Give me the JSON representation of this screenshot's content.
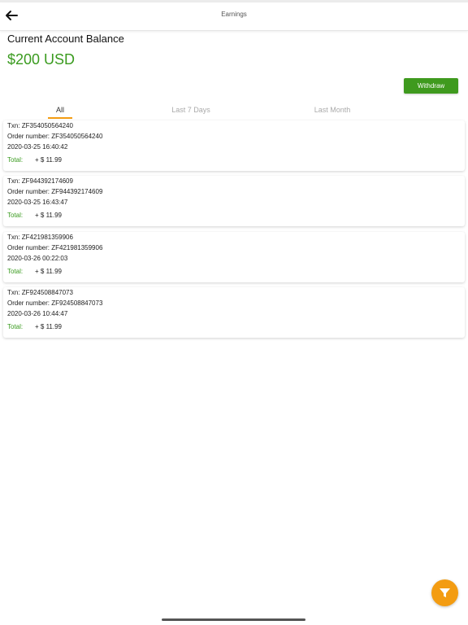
{
  "header": {
    "title": "Earnings",
    "back_icon": "arrow-left-icon"
  },
  "balance": {
    "label": "Current Account Balance",
    "value": "$200 USD"
  },
  "withdraw": {
    "label": "Withdraw"
  },
  "tabs": [
    {
      "label": "All",
      "active": true
    },
    {
      "label": "Last 7 Days",
      "active": false
    },
    {
      "label": "Last Month",
      "active": false
    }
  ],
  "transactions": [
    {
      "txn": "Txn: ZF354050564240",
      "order": "Order number: ZF354050564240",
      "date": "2020-03-25 16:40:42",
      "total_label": "Total:",
      "total_value": "+ $ 11.99"
    },
    {
      "txn": "Txn: ZF944392174609",
      "order": "Order number: ZF944392174609",
      "date": "2020-03-25 16:43:47",
      "total_label": "Total:",
      "total_value": "+ $ 11.99"
    },
    {
      "txn": "Txn: ZF421981359906",
      "order": "Order number: ZF421981359906",
      "date": "2020-03-26 00:22:03",
      "total_label": "Total:",
      "total_value": "+ $ 11.99"
    },
    {
      "txn": "Txn: ZF924508847073",
      "order": "Order number: ZF924508847073",
      "date": "2020-03-26 10:44:47",
      "total_label": "Total:",
      "total_value": "+ $ 11.99"
    }
  ],
  "filter": {
    "icon": "filter-icon"
  },
  "colors": {
    "accent_green": "#3a9b1f",
    "button_green": "#3f9a1e",
    "accent_orange": "#f39c12"
  }
}
